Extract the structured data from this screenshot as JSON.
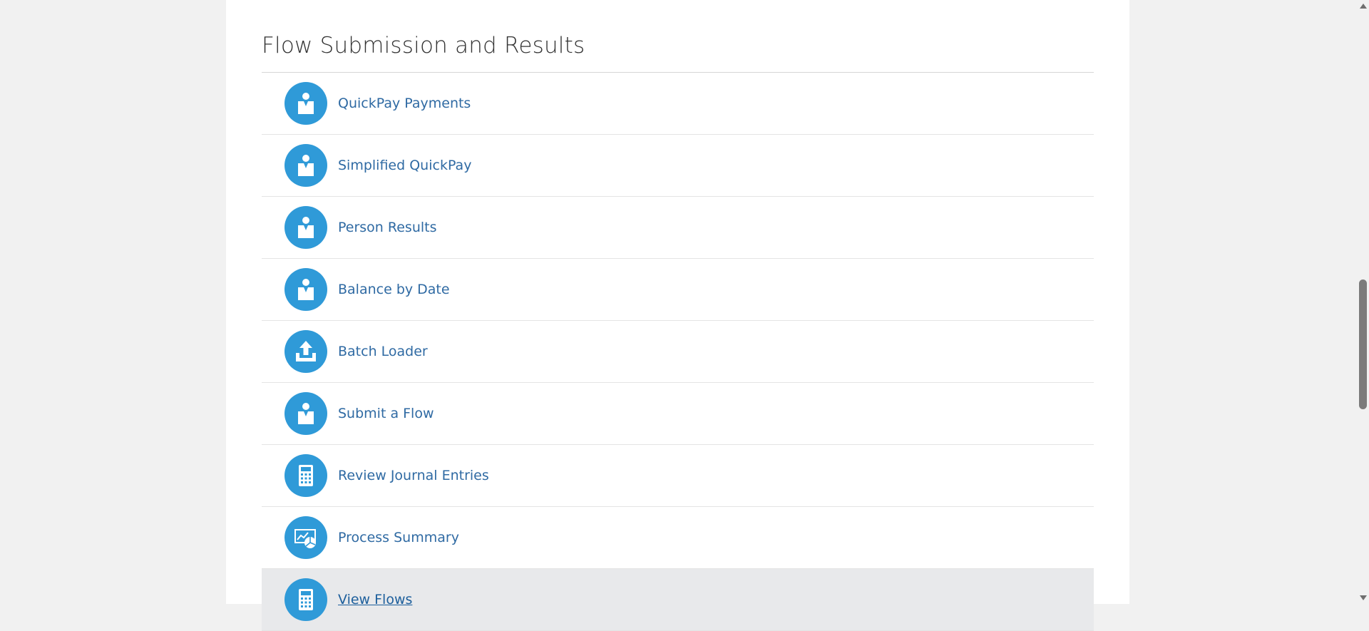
{
  "section": {
    "title": "Flow Submission and Results"
  },
  "tasks": [
    {
      "label": "QuickPay Payments",
      "icon": "person-icon"
    },
    {
      "label": "Simplified QuickPay",
      "icon": "person-icon"
    },
    {
      "label": "Person Results",
      "icon": "person-icon"
    },
    {
      "label": "Balance by Date",
      "icon": "person-icon"
    },
    {
      "label": "Batch Loader",
      "icon": "upload-icon"
    },
    {
      "label": "Submit a Flow",
      "icon": "person-icon"
    },
    {
      "label": "Review Journal Entries",
      "icon": "calculator-icon"
    },
    {
      "label": "Process Summary",
      "icon": "report-icon"
    },
    {
      "label": "View Flows",
      "icon": "calculator-icon",
      "hovered": true
    }
  ],
  "colors": {
    "icon_bg": "#2f9ad8",
    "link": "#2f6aa3",
    "hover_bg": "#e8e9eb"
  }
}
